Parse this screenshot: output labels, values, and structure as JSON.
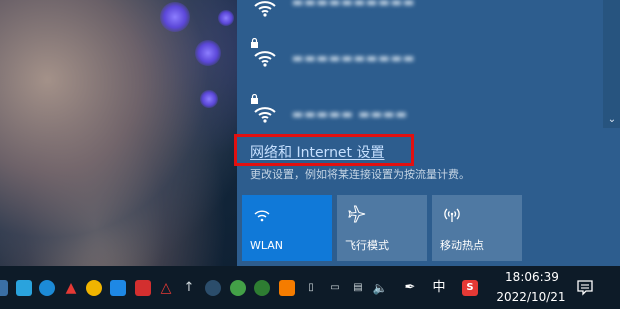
{
  "action_center": {
    "networks": [
      {
        "name": "▬▬▬▬▬▬▬▬▬▬",
        "secured": false
      },
      {
        "name": "▬▬▬▬▬▬▬▬▬▬",
        "secured": true
      },
      {
        "name": "▬▬▬▬▬ ▬▬▬▬",
        "secured": true
      }
    ],
    "settings_link": "网络和 Internet 设置",
    "settings_desc": "更改设置，例如将某连接设置为按流量计费。",
    "tiles": [
      {
        "label": "WLAN",
        "icon": "wifi-icon",
        "active": true
      },
      {
        "label": "飞行模式",
        "icon": "airplane-icon",
        "active": false
      },
      {
        "label": "移动热点",
        "icon": "hotspot-icon",
        "active": false
      }
    ]
  },
  "taskbar": {
    "time": "18:06:39",
    "date": "2022/10/21",
    "ime": "中",
    "ime_s": "S",
    "accent": "#0078d7"
  },
  "colors": {
    "panel_bg": "#2d5d8e",
    "tile_active": "#1079d8",
    "highlight": "#e21010"
  }
}
